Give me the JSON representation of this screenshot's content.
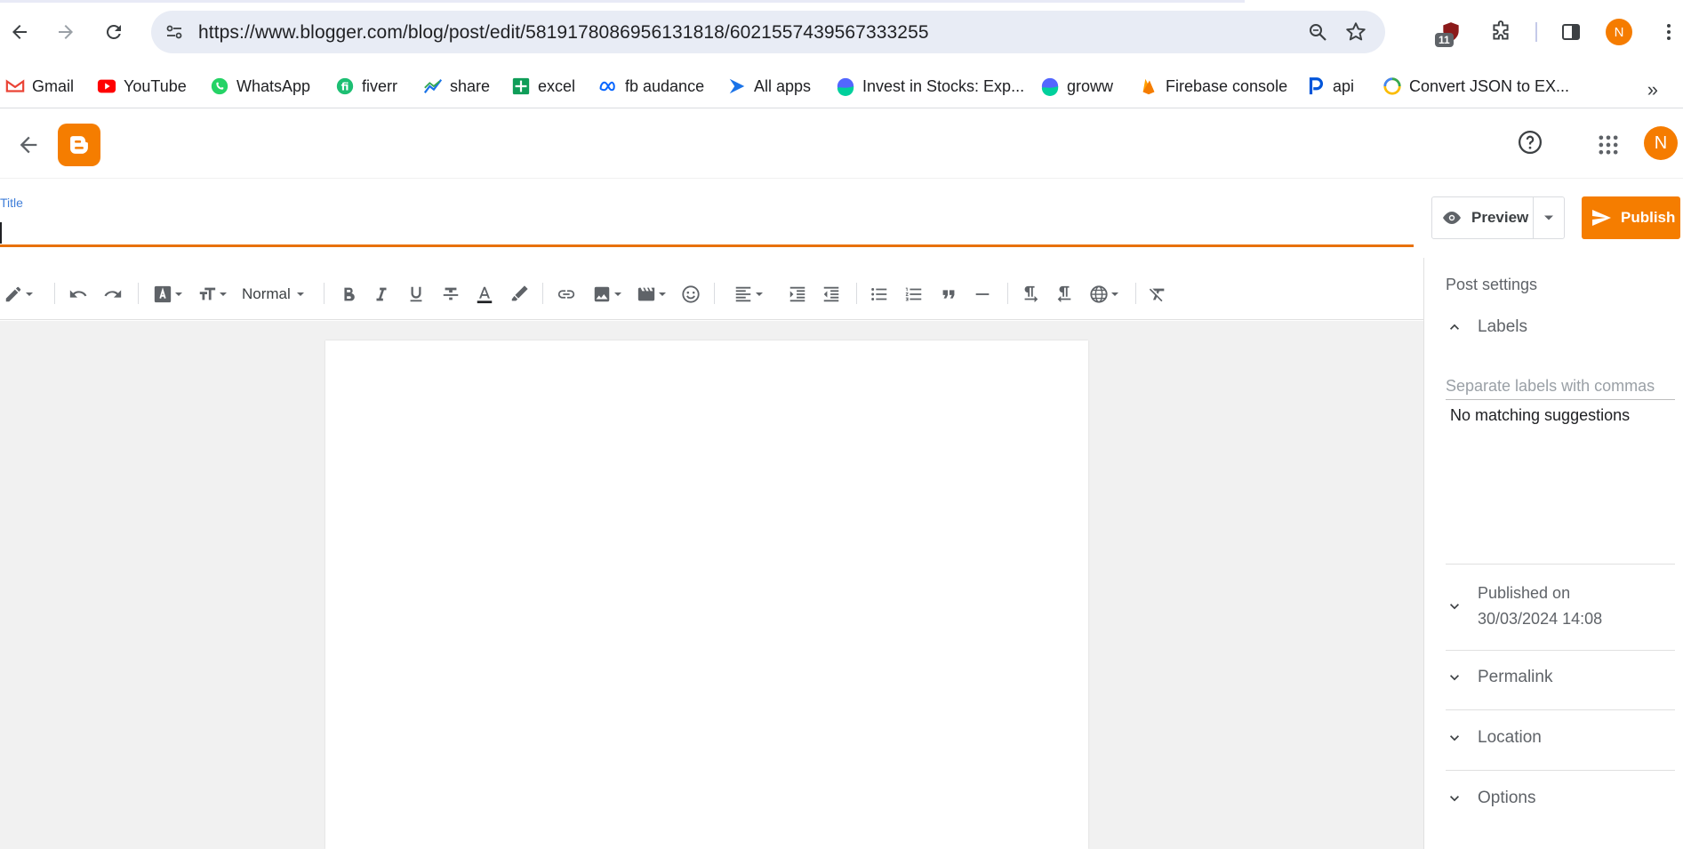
{
  "browser": {
    "url": "https://www.blogger.com/blog/post/edit/5819178086956131818/6021557439567333255",
    "extension_badge": "11",
    "profile_initial": "N",
    "bookmarks": [
      {
        "label": "Gmail",
        "icon": "gmail-icon"
      },
      {
        "label": "YouTube",
        "icon": "youtube-icon"
      },
      {
        "label": "WhatsApp",
        "icon": "whatsapp-icon"
      },
      {
        "label": "fiverr",
        "icon": "fiverr-icon"
      },
      {
        "label": "share",
        "icon": "share-chart-icon"
      },
      {
        "label": "excel",
        "icon": "excel-icon"
      },
      {
        "label": "fb audance",
        "icon": "meta-icon"
      },
      {
        "label": "All apps",
        "icon": "play-console-icon"
      },
      {
        "label": "Invest in Stocks: Exp...",
        "icon": "groww-icon"
      },
      {
        "label": "groww",
        "icon": "groww-icon"
      },
      {
        "label": "Firebase console",
        "icon": "firebase-icon"
      },
      {
        "label": "api",
        "icon": "rapidapi-icon"
      },
      {
        "label": "Convert JSON to EX...",
        "icon": "converter-icon"
      }
    ]
  },
  "app": {
    "avatar_initial": "N",
    "title_label": "Title",
    "title_value": "",
    "preview_label": "Preview",
    "publish_label": "Publish",
    "toolbar": {
      "paragraph_style": "Normal"
    }
  },
  "sidebar": {
    "title": "Post settings",
    "labels_section": "Labels",
    "labels_placeholder": "Separate labels with commas",
    "no_match": "No matching suggestions",
    "published_line1": "Published on",
    "published_line2": "30/03/2024 14:08",
    "permalink": "Permalink",
    "location": "Location",
    "options": "Options"
  },
  "colors": {
    "accent": "#f57d00",
    "title_underline": "#e8710a",
    "title_label": "#3f7ed9",
    "editor_bg": "#f1f1f1"
  }
}
